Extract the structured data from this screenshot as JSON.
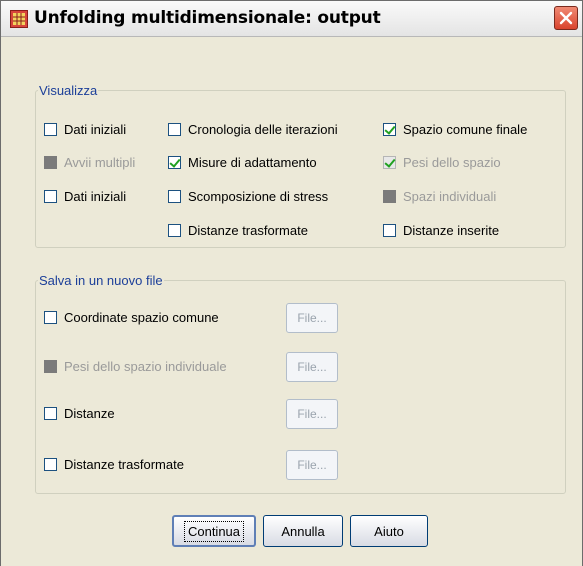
{
  "window": {
    "title": "Unfolding multidimensionale: output"
  },
  "visualizza": {
    "legend": "Visualizza",
    "items": [
      {
        "label": "Dati iniziali",
        "checked": false,
        "disabled": false
      },
      {
        "label": "Avvii multipli",
        "checked": false,
        "disabled": true
      },
      {
        "label": "Dati iniziali",
        "checked": false,
        "disabled": false
      },
      {
        "label": "Cronologia delle iterazioni",
        "checked": false,
        "disabled": false
      },
      {
        "label": "Misure di adattamento",
        "checked": true,
        "disabled": false
      },
      {
        "label": "Scomposizione di stress",
        "checked": false,
        "disabled": false
      },
      {
        "label": "Distanze trasformate",
        "checked": false,
        "disabled": false
      },
      {
        "label": "Spazio comune finale",
        "checked": true,
        "disabled": false
      },
      {
        "label": "Pesi dello spazio",
        "checked": true,
        "disabled": true
      },
      {
        "label": "Spazi individuali",
        "checked": false,
        "disabled": true
      },
      {
        "label": "Distanze inserite",
        "checked": false,
        "disabled": false
      }
    ]
  },
  "salva": {
    "legend": "Salva in un nuovo file",
    "items": [
      {
        "label": "Coordinate spazio comune",
        "checked": false,
        "disabled": false,
        "file_label": "File..."
      },
      {
        "label": "Pesi dello spazio individuale",
        "checked": false,
        "disabled": true,
        "file_label": "File..."
      },
      {
        "label": "Distanze",
        "checked": false,
        "disabled": false,
        "file_label": "File..."
      },
      {
        "label": "Distanze trasformate",
        "checked": false,
        "disabled": false,
        "file_label": "File..."
      }
    ]
  },
  "buttons": {
    "continue": "Continua",
    "cancel": "Annulla",
    "help": "Aiuto"
  }
}
